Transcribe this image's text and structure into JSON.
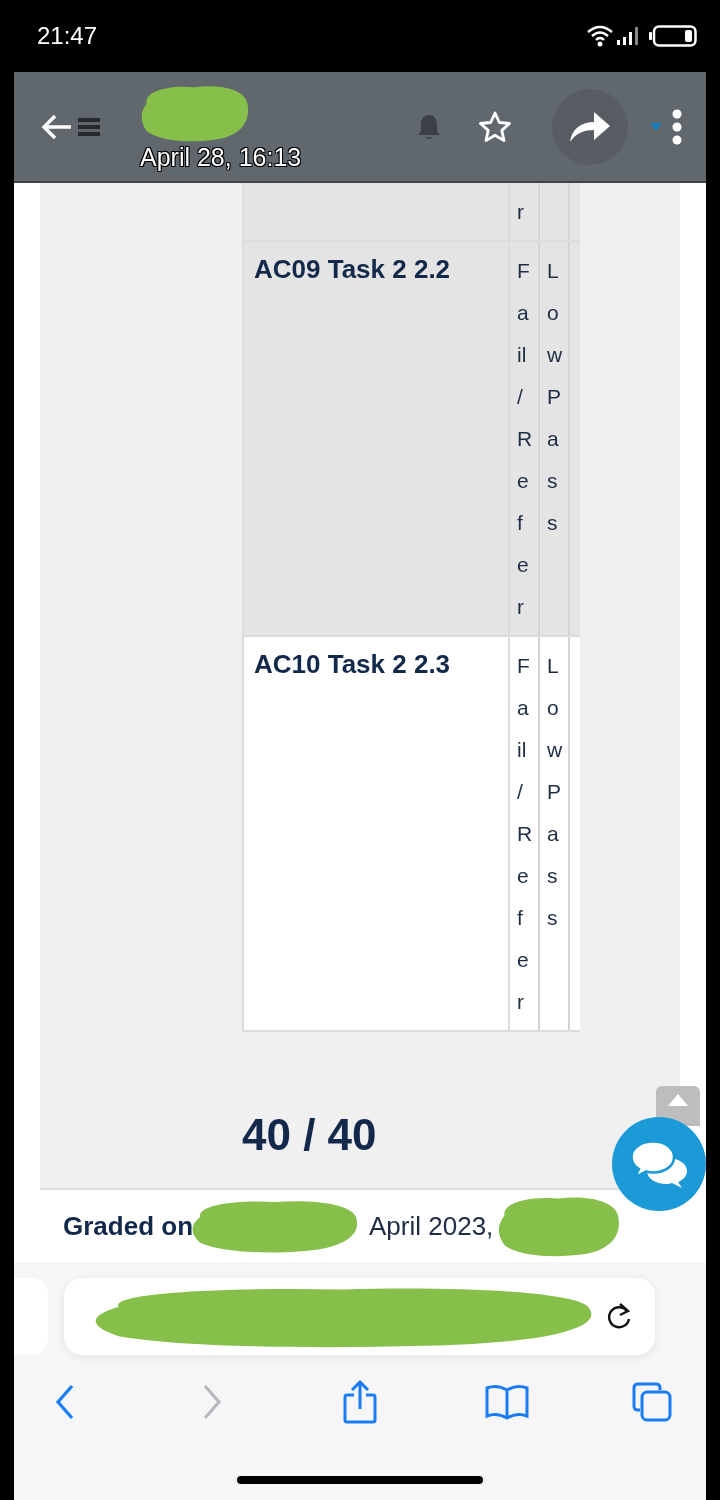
{
  "status_bar": {
    "time": "21:47"
  },
  "viewer": {
    "timestamp": "April 28, 16:13"
  },
  "table": {
    "rows": [
      {
        "shaded": true,
        "column_2": "r"
      },
      {
        "shaded": true,
        "column_1": "AC09 Task 2 2.2",
        "column_2": "Fail / Refer",
        "column_3": "Low Pass"
      },
      {
        "shaded": false,
        "column_1": "AC10 Task 2 2.3",
        "column_2": "Fail / Refer",
        "column_3": "Low Pass"
      }
    ]
  },
  "score": "40 / 40",
  "graded": {
    "label": "Graded on",
    "date": "April 2023,"
  }
}
